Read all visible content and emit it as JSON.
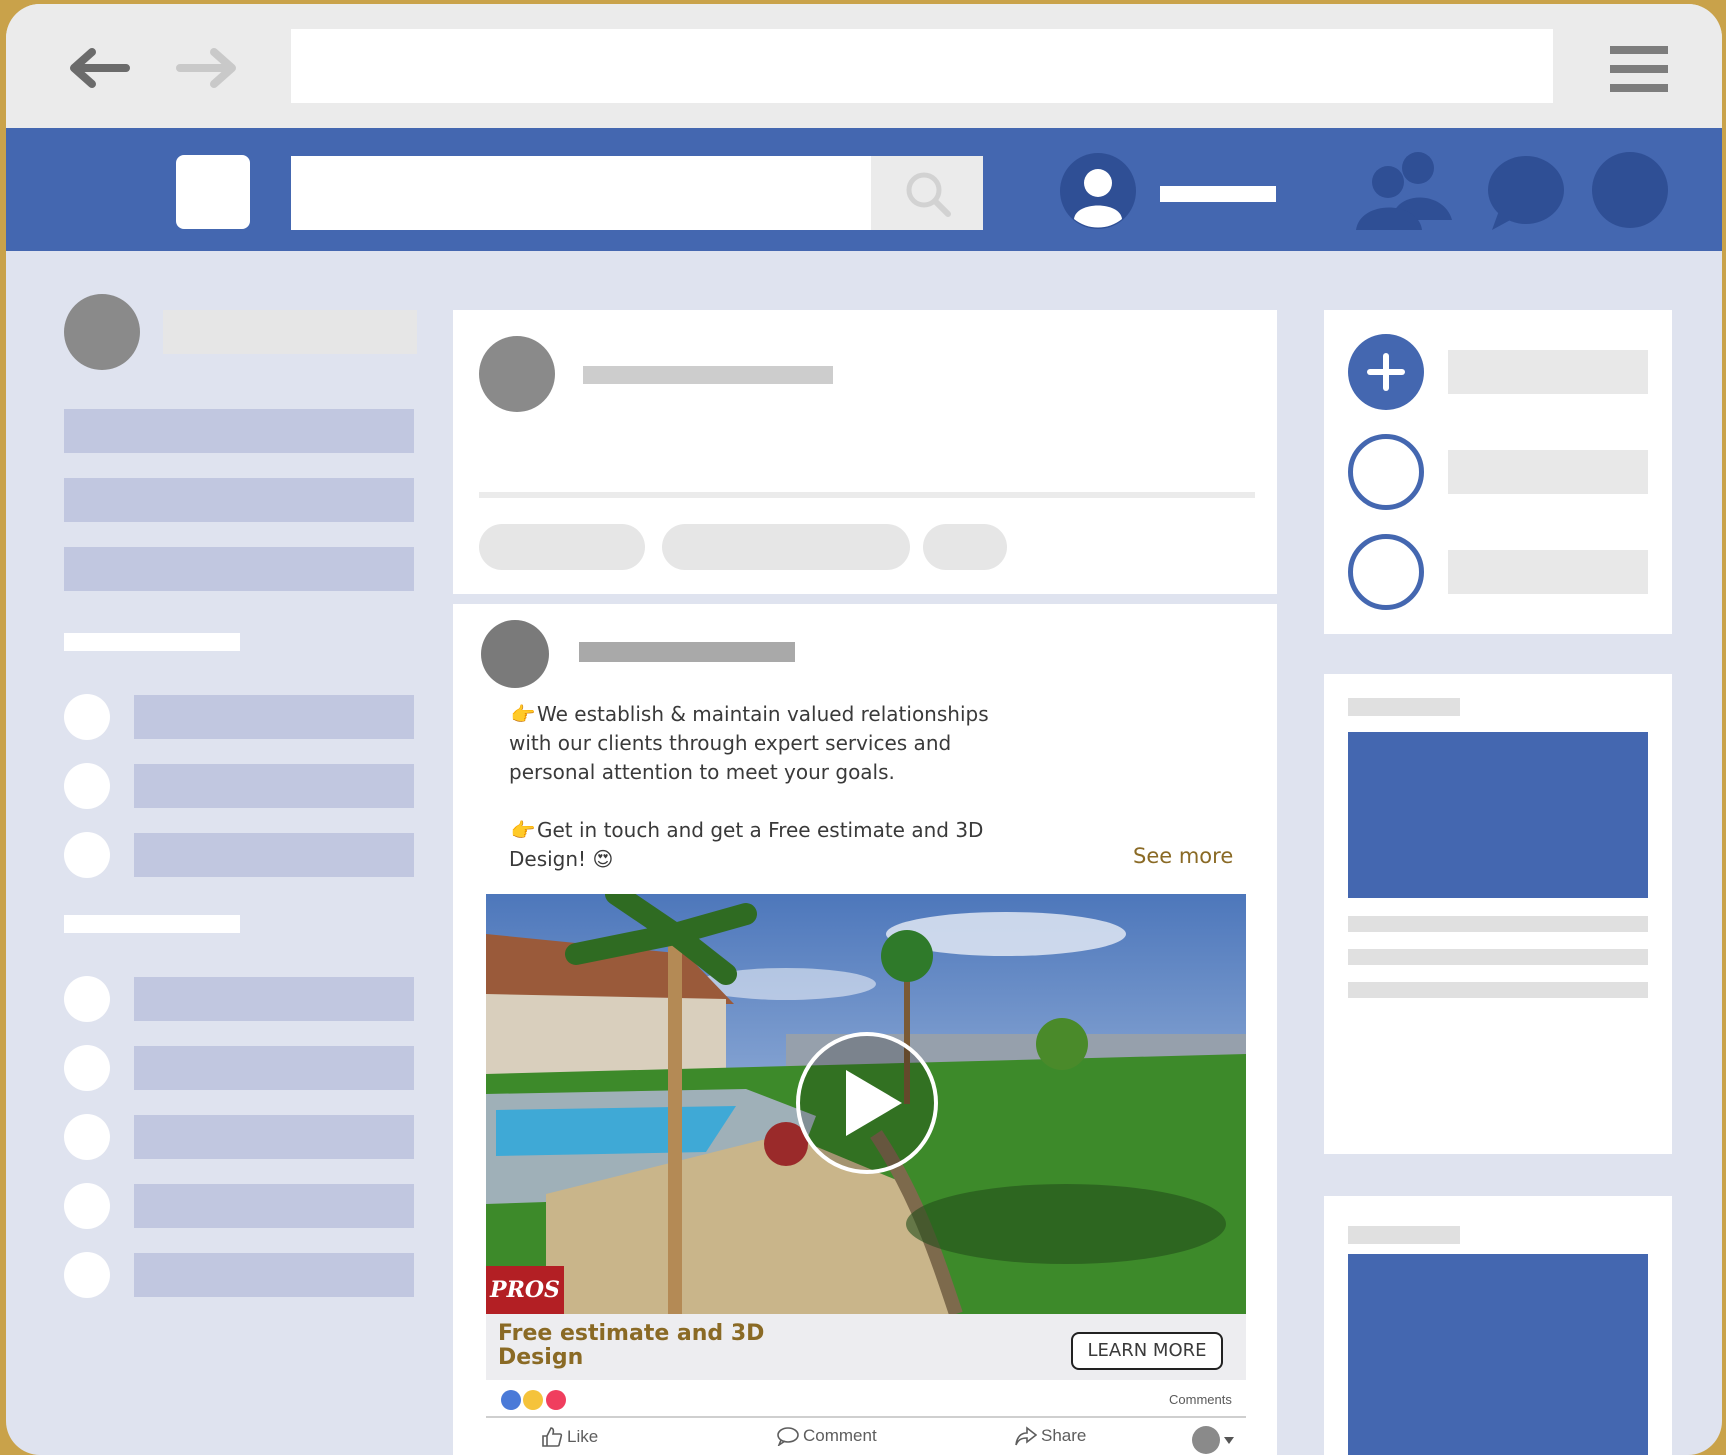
{
  "post": {
    "line1": "We establish & maintain valued relationships with our clients through expert services and personal attention to meet your goals.",
    "line2": "Get in touch and get a Free estimate and 3D Design!",
    "see_more": "See more",
    "video_badge": "PROS",
    "cta_title": "Free estimate and 3D Design",
    "cta_button": "LEARN MORE",
    "comments_link": "Comments",
    "actions": {
      "like": "Like",
      "comment": "Comment",
      "share": "Share"
    }
  },
  "icons": {
    "back": "arrow-left-icon",
    "forward": "arrow-right-icon",
    "menu": "hamburger-menu-icon",
    "search": "search-icon",
    "profile": "user-icon",
    "friends": "friends-icon",
    "messages": "chat-bubble-icon",
    "notifications": "notifications-icon",
    "play": "play-icon",
    "add": "plus-icon"
  },
  "colors": {
    "brand_blue": "#4467b0",
    "page_bg": "#dfe3ef",
    "accent_gold": "#8a6a25"
  }
}
